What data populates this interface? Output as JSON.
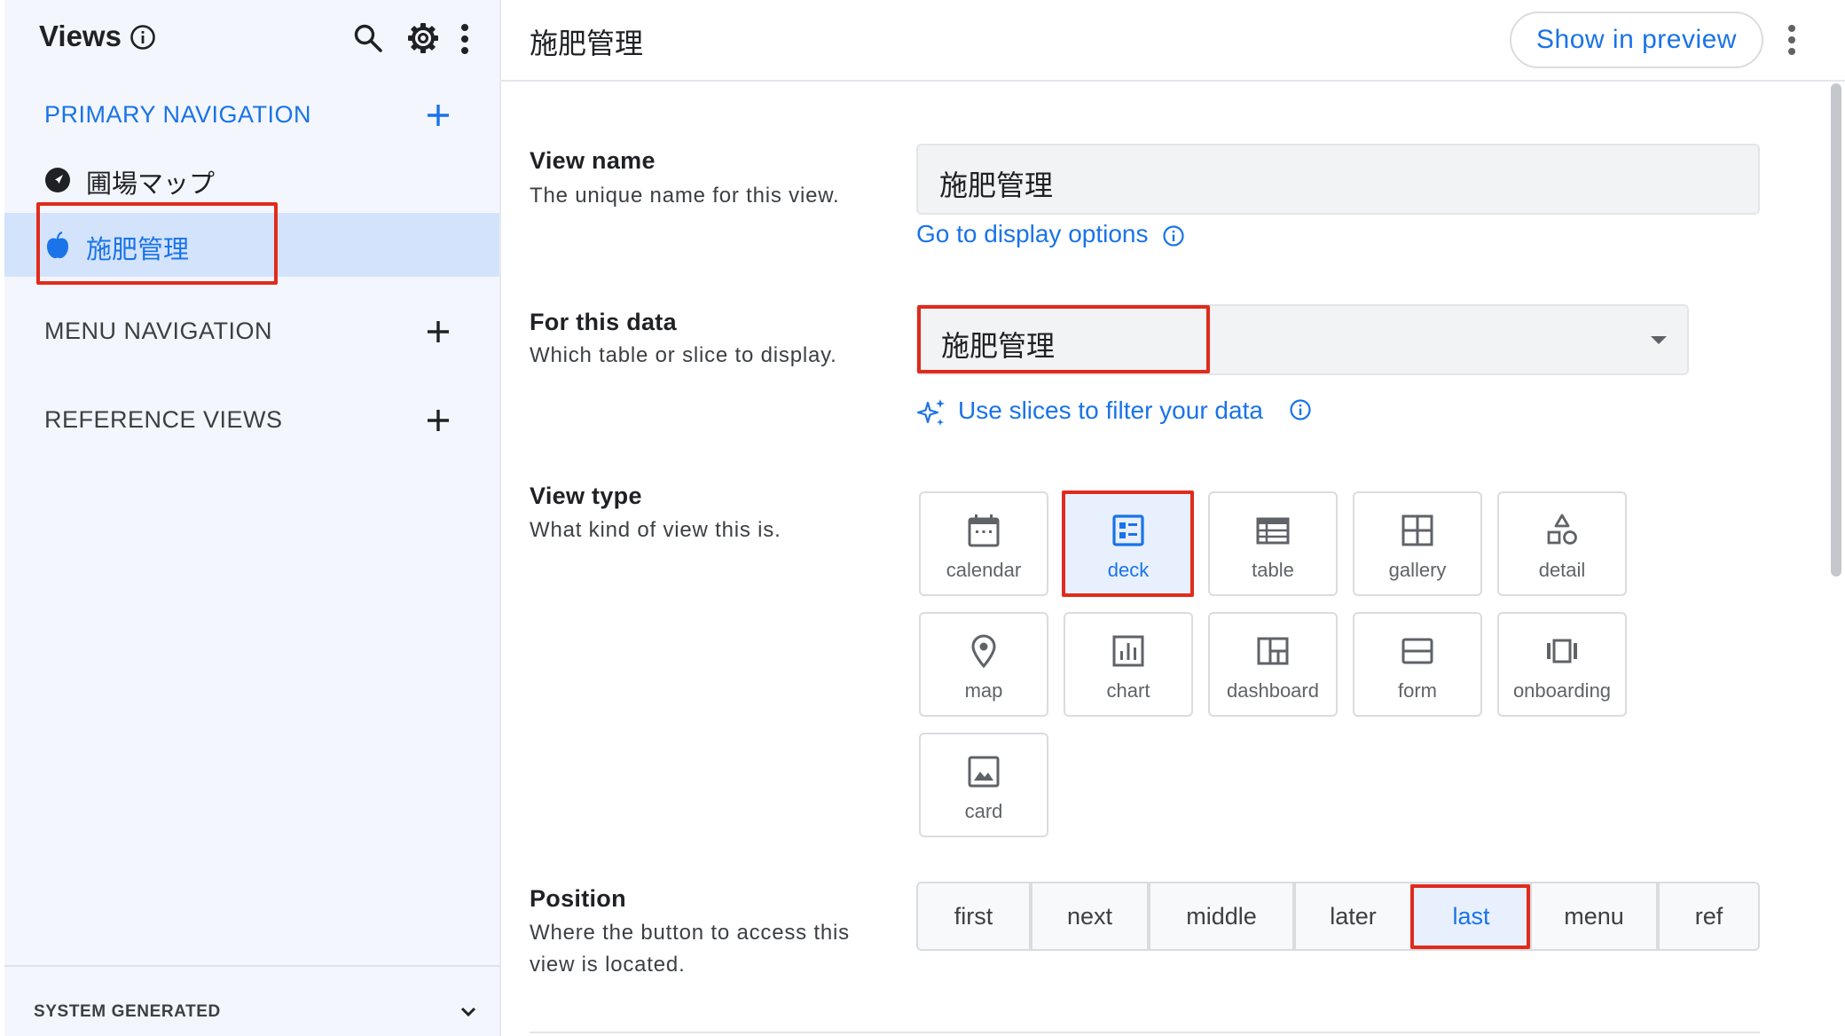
{
  "sidebar": {
    "title": "Views",
    "sections": {
      "primary": "PRIMARY NAVIGATION",
      "menu": "MENU NAVIGATION",
      "reference": "REFERENCE VIEWS",
      "system": "SYSTEM GENERATED"
    },
    "primary_items": [
      {
        "label": "圃場マップ",
        "icon": "navigation-arrow-icon"
      },
      {
        "label": "施肥管理",
        "icon": "apple-icon",
        "selected": true
      }
    ]
  },
  "header": {
    "title": "施肥管理",
    "preview_label": "Show in preview"
  },
  "form": {
    "view_name": {
      "label": "View name",
      "desc": "The unique name for this view.",
      "value": "施肥管理",
      "link": "Go to display options"
    },
    "for_this_data": {
      "label": "For this data",
      "desc": "Which table or slice to display.",
      "value": "施肥管理",
      "link": "Use slices to filter your data"
    },
    "view_type": {
      "label": "View type",
      "desc": "What kind of view this is.",
      "options": [
        "calendar",
        "deck",
        "table",
        "gallery",
        "detail",
        "map",
        "chart",
        "dashboard",
        "form",
        "onboarding",
        "card"
      ],
      "selected": "deck"
    },
    "position": {
      "label": "Position",
      "desc_line1": "Where the button to access this",
      "desc_line2": "view is located.",
      "options": [
        "first",
        "next",
        "middle",
        "later",
        "last",
        "menu",
        "ref"
      ],
      "selected": "last"
    }
  },
  "colors": {
    "accent": "#1a73e8",
    "highlight_box": "#e02b1c",
    "sidebar_bg": "#f3f7fd",
    "selected_bg": "#d3e3fc"
  }
}
